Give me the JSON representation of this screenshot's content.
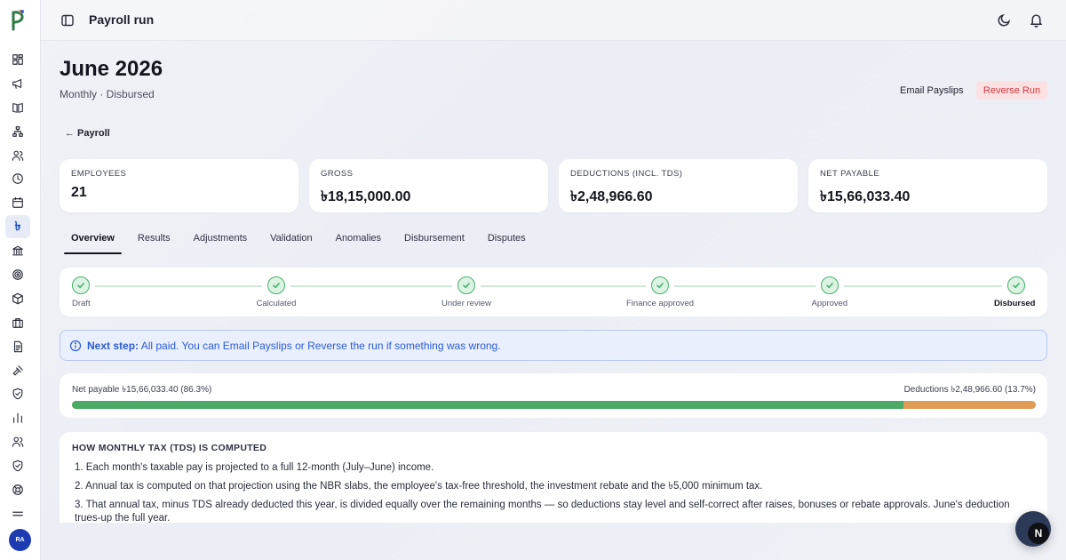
{
  "app": {
    "currency_sidebar_glyph": "৳",
    "avatar_initials": "RA",
    "sidebar_icons": [
      "dashboard-icon",
      "megaphone-icon",
      "book-icon",
      "org-chart-icon",
      "users-icon",
      "clock-icon",
      "calendar-icon",
      "payroll-icon",
      "bank-icon",
      "target-icon",
      "package-icon",
      "briefcase-icon",
      "document-icon",
      "gavel-icon",
      "shield-icon",
      "bar-chart-icon",
      "people-icon",
      "shield-check-icon",
      "support-icon",
      "more-icon"
    ]
  },
  "topbar": {
    "title": "Payroll run"
  },
  "header": {
    "title": "June 2026",
    "subtitle": "Monthly · Disbursed",
    "email_button": "Email Payslips",
    "reverse_button": "Reverse Run",
    "back_link": "← Payroll"
  },
  "stats": [
    {
      "label": "EMPLOYEES",
      "value": "21"
    },
    {
      "label": "GROSS",
      "value": "৳18,15,000.00"
    },
    {
      "label": "DEDUCTIONS (INCL. TDS)",
      "value": "৳2,48,966.60"
    },
    {
      "label": "NET PAYABLE",
      "value": "৳15,66,033.40"
    }
  ],
  "tabs": [
    "Overview",
    "Results",
    "Adjustments",
    "Validation",
    "Anomalies",
    "Disbursement",
    "Disputes"
  ],
  "active_tab": "Overview",
  "steps": [
    "Draft",
    "Calculated",
    "Under review",
    "Finance approved",
    "Approved",
    "Disbursed"
  ],
  "next_step": {
    "label": "Next step:",
    "text": " All paid. You can Email Payslips or Reverse the run if something was wrong."
  },
  "split": {
    "left": "Net payable ৳15,66,033.40 (86.3%)",
    "right": "Deductions ৳2,48,966.60 (13.7%)",
    "net_fraction": 0.863
  },
  "explain": {
    "title": "HOW MONTHLY TAX (TDS) IS COMPUTED",
    "items": [
      "1. Each month's taxable pay is projected to a full 12-month (July–June) income.",
      "2. Annual tax is computed on that projection using the NBR slabs, the employee's tax-free threshold, the investment rebate and the ৳5,000 minimum tax.",
      "3. That annual tax, minus TDS already deducted this year, is divided equally over the remaining months — so deductions stay level and self-correct after raises, bonuses or rebate approvals. June's deduction trues-up the full year."
    ]
  },
  "colors": {
    "accent": "#1f4fd1",
    "success": "#46b06a",
    "danger": "#d9363e",
    "deduction": "#e09b55",
    "net": "#4aaa66"
  }
}
